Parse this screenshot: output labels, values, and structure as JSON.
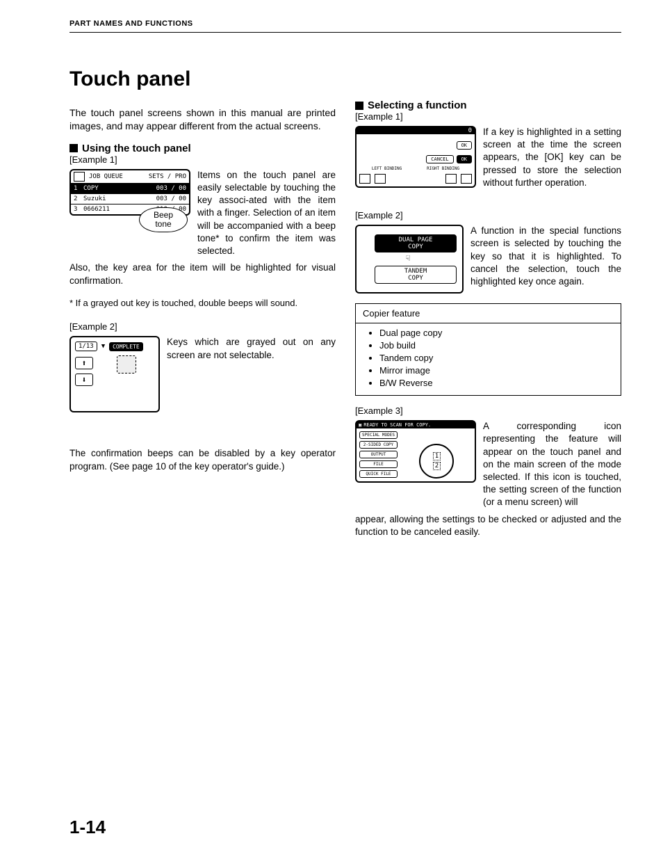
{
  "header": "PART NAMES AND FUNCTIONS",
  "title": "Touch panel",
  "page_number": "1-14",
  "left": {
    "intro": "The touch panel screens shown in this manual are printed images, and may appear different from the actual screens.",
    "h_using": "Using the touch panel",
    "ex1": "[Example 1]",
    "ex2": "[Example 2]",
    "para1a": "Items on the touch panel are easily selectable by touching the key associ-ated with the item with a finger. Selection of an item will be accompanied with a beep tone* to confirm the item was selected.",
    "para1b": "Also, the key area for the item will be highlighted for visual confirmation.",
    "note": "* If a grayed out key is touched, double beeps will sound.",
    "para2": "Keys which are grayed out on any screen are not selectable.",
    "para3": "The confirmation beeps can be disabled by a key operator program. (See page 10 of the key operator's guide.)",
    "fig1": {
      "header": "JOB QUEUE",
      "header2": "SETS / PRO",
      "row1_name": "COPY",
      "row1_val": "003 / 00",
      "row2_name": "Suzuki",
      "row2_val": "003 / 00",
      "row3_name": "0666211",
      "row3_val": "010 / 00",
      "bubble1": "Beep",
      "bubble2": "tone"
    },
    "fig2": {
      "count": "1/13",
      "complete": "COMPLETE",
      "up": "⬆",
      "down": "⬇"
    }
  },
  "right": {
    "h_select": "Selecting a function",
    "ex1": "[Example 1]",
    "ex2": "[Example 2]",
    "ex3": "[Example 3]",
    "para1": "If a key is highlighted in a setting screen at the time the screen appears, the [OK] key can be pressed to store the selection without further operation.",
    "para2": "A function in the special functions screen is selected by touching the key so that it is highlighted. To cancel the selection, touch the highlighted key once again.",
    "para3a": "A corresponding icon representing the feature will appear on the touch panel and on the main screen of the mode selected. If this icon is touched, the setting screen of the function (or a menu screen) will",
    "para3b": "appear, allowing the settings to be checked or adjusted and the function to be canceled easily.",
    "fig3": {
      "zero": "0",
      "cancel": "CANCEL",
      "ok": "OK",
      "bind_l": "LEFT BINDING",
      "bind_r": "RIGHT BINDING"
    },
    "fig4": {
      "opt1a": "DUAL PAGE",
      "opt1b": "COPY",
      "opt2a": "TANDEM",
      "opt2b": "COPY"
    },
    "table": {
      "title": "Copier feature",
      "items": [
        "Dual page copy",
        "Job build",
        "Tandem copy",
        "Mirror image",
        "B/W Reverse"
      ]
    },
    "fig5": {
      "bar": "READY TO SCAN FOR COPY.",
      "btns": [
        "SPECIAL MODES",
        "2-SIDED COPY",
        "OUTPUT",
        "FILE",
        "QUICK FILE"
      ],
      "ring1": "1",
      "ring2": "2"
    }
  }
}
